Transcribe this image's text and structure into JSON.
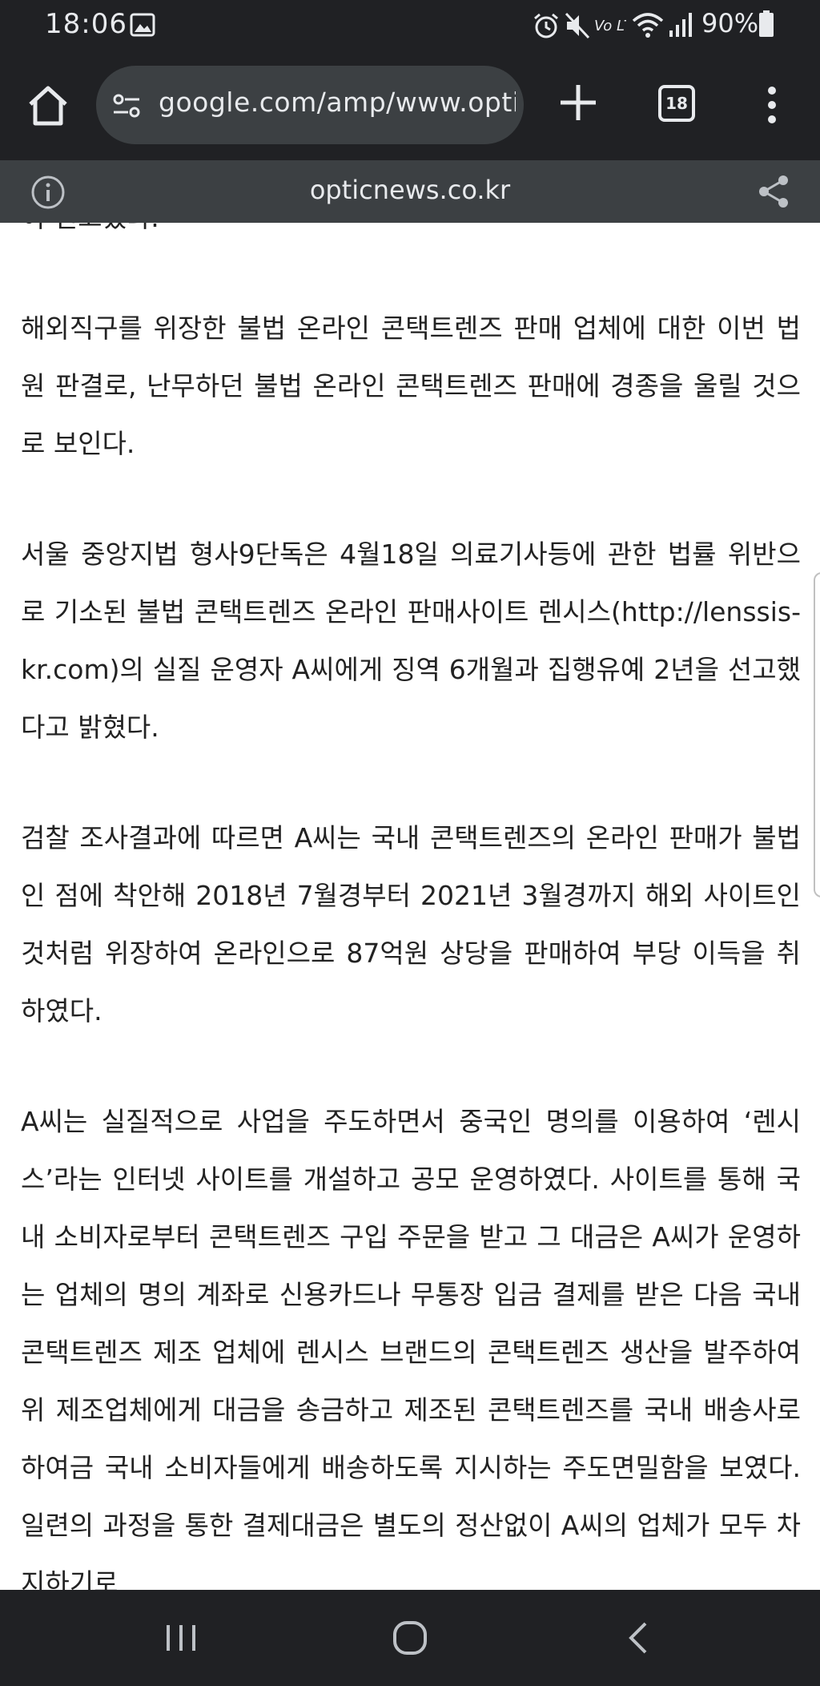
{
  "status_bar": {
    "time": "18:06",
    "battery_text": "90%",
    "network_label": "Vo LTE"
  },
  "browser": {
    "url": "google.com/amp/www.optic",
    "tab_count": "18",
    "amp_domain": "opticnews.co.kr"
  },
  "article": {
    "top_fragment": "이 선고했다.",
    "paragraphs": [
      "해외직구를 위장한 불법 온라인 콘택트렌즈 판매 업체에 대한 이번 법원 판결로, 난무하던 불법 온라인 콘택트렌즈 판매에 경종을 울릴 것으로 보인다.",
      "서울 중앙지법 형사9단독은 4월18일 의료기사등에 관한 법률 위반으로 기소된 불법 콘택트렌즈 온라인 판매사이트 렌시스(http://lenssis-kr.com)의 실질 운영자 A씨에게 징역 6개월과 집행유예 2년을 선고했다고 밝혔다.",
      "검찰 조사결과에 따르면 A씨는 국내 콘택트렌즈의 온라인 판매가 불법인 점에 착안해 2018년 7월경부터 2021년 3월경까지 해외 사이트인 것처럼 위장하여 온라인으로 87억원 상당을 판매하여 부당 이득을 취하였다.",
      "A씨는 실질적으로 사업을 주도하면서 중국인 명의를 이용하여 ‘렌시스’라는 인터넷 사이트를 개설하고 공모 운영하였다. 사이트를 통해 국내 소비자로부터 콘택트렌즈 구입 주문을 받고 그 대금은 A씨가 운영하는 업체의 명의 계좌로 신용카드나 무통장 입금 결제를 받은 다음 국내 콘택트렌즈 제조 업체에 렌시스 브랜드의 콘택트렌즈 생산을 발주하여 위 제조업체에게 대금을 송금하고 제조된 콘택트렌즈를 국내 배송사로 하여금 국내 소비자들에게 배송하도록 지시하는 주도면밀함을 보였다. 일련의 과정을 통한 결제대금은 별도의 정산없이 A씨의 업체가 모두 차지하기로"
    ]
  },
  "colors": {
    "chrome_dark": "#202124",
    "chrome_bar": "#3c4043",
    "chrome_text": "#e8eaed",
    "article_text": "#222222"
  },
  "icons": [
    "image-icon",
    "alarm-icon",
    "mute-icon",
    "wifi-icon",
    "signal-icon",
    "battery-icon",
    "home-icon",
    "tune-icon",
    "plus-icon",
    "tab-switcher-icon",
    "more-vert-icon",
    "info-icon",
    "share-icon",
    "recents-icon",
    "home-circle-icon",
    "back-icon"
  ]
}
